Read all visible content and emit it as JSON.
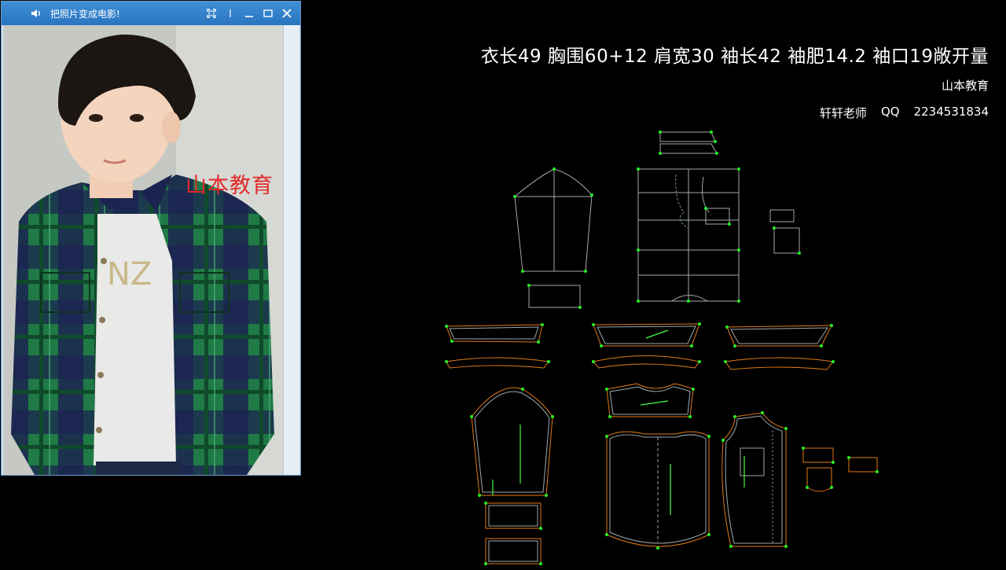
{
  "window": {
    "title": "把照片变成电影!",
    "watermark": "山本教育",
    "icons": [
      "speaker-icon",
      "fullscreen-icon",
      "minimize-icon",
      "maximize-icon",
      "close-icon"
    ]
  },
  "spec_line": "衣长49  胸围60+12  肩宽30  袖长42  袖肥14.2  袖口19敞开量",
  "brand": "山本教育",
  "teacher": "轩轩老师",
  "qq_label": "QQ",
  "qq_number": "2234531834",
  "colors": {
    "background": "#000000",
    "pattern_line": "#a0a8a8",
    "seam_allowance": "#e07a1a",
    "point_marker": "#22ee22",
    "grain_line": "#44ff44",
    "watermark": "#e22a2a",
    "shirt_green": "#1f7a45",
    "shirt_navy": "#1b2450"
  }
}
